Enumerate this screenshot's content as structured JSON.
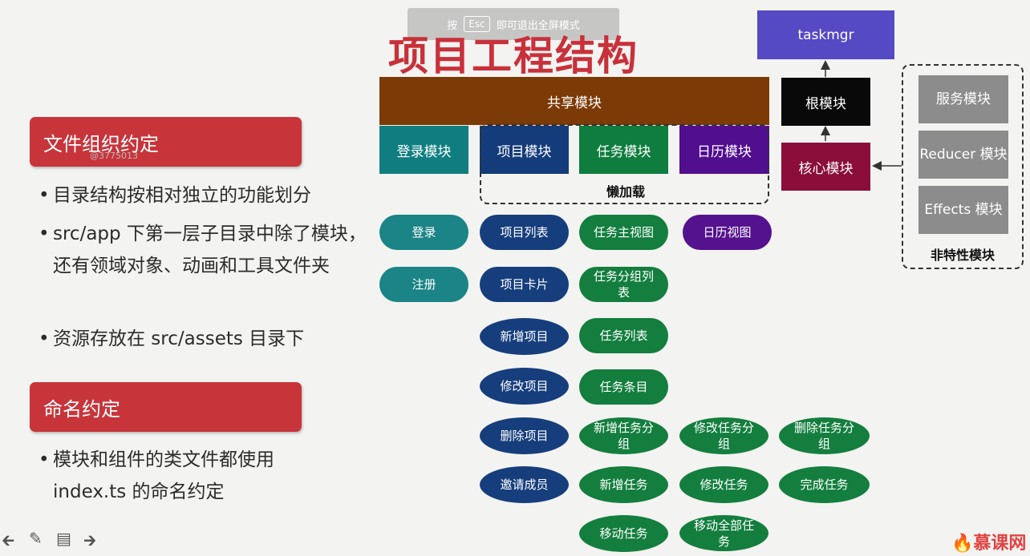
{
  "overlay": {
    "hint_prefix": "按",
    "hint_key": "Esc",
    "hint_suffix": "即可退出全屏模式"
  },
  "title": "项目工程结构",
  "sections": [
    {
      "heading": "文件组织约定"
    },
    {
      "heading": "命名约定"
    }
  ],
  "watermark": "@3775013",
  "bullets_1": [
    "目录结构按相对独立的功能划分",
    "src/app 下第一层子目录中除了模块，还有领域对象、动画和工具文件夹",
    "资源存放在 src/assets 目录下"
  ],
  "bullets_2": [
    "模块和组件的类文件都使用index.ts 的命名约定"
  ],
  "bullet_symbol": "•",
  "diagram": {
    "shared": "共享模块",
    "modules": [
      "登录模块",
      "项目模块",
      "任务模块",
      "日历模块"
    ],
    "lazy": "懒加载",
    "root_app": "taskmgr",
    "root": "根模块",
    "core": "核心模块",
    "services": [
      "服务模块",
      "Reducer 模块",
      "Effects 模块"
    ],
    "nonfeature": "非特性模块",
    "login_items": [
      "登录",
      "注册"
    ],
    "project_items": [
      "项目列表",
      "项目卡片",
      "新增项目",
      "修改项目",
      "删除项目",
      "邀请成员"
    ],
    "task_items": [
      "任务主视图",
      "任务分组列表",
      "任务列表",
      "任务条目",
      "新增任务分组",
      "新增任务",
      "移动任务"
    ],
    "task_extra_1": [
      "修改任务分组",
      "删除任务分组"
    ],
    "task_extra_2": [
      "修改任务",
      "完成任务"
    ],
    "task_extra_3": "移动全部任务",
    "calendar_items": [
      "日历视图"
    ]
  },
  "footer": {
    "logo": "慕课网",
    "icons": [
      "arrow-left-icon",
      "pencil-icon",
      "notes-icon",
      "arrow-right-icon"
    ]
  },
  "colors": {
    "accent_red": "#c7353b",
    "shared_brown": "#7c3a06",
    "teal": "#107e80",
    "navy": "#143b7a",
    "green": "#0e7d3e",
    "purple": "#510e8f"
  }
}
